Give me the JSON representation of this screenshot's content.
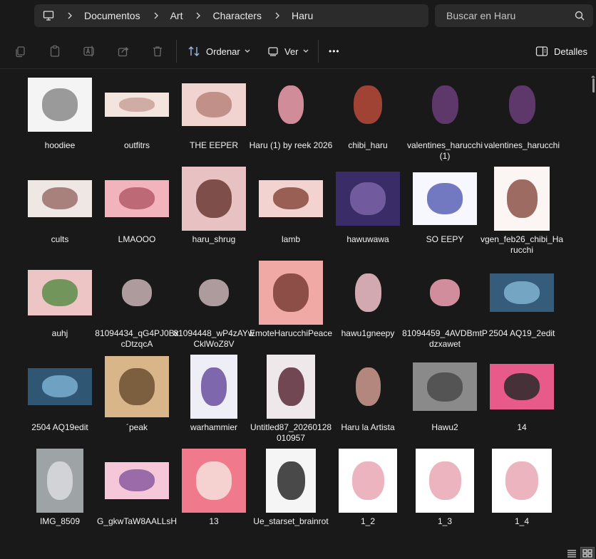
{
  "breadcrumb": {
    "items": [
      "Documentos",
      "Art",
      "Characters",
      "Haru"
    ]
  },
  "search": {
    "placeholder": "Buscar en Haru"
  },
  "toolbar": {
    "sort_label": "Ordenar",
    "view_label": "Ver",
    "details_label": "Detalles",
    "more_label": "•••"
  },
  "files": [
    {
      "name": "hoodiee",
      "thumb": "#f4f4f4",
      "accent": "#8a8a8a"
    },
    {
      "name": "outfitrs",
      "thumb": "#f3e4dd",
      "accent": "#c9a39a"
    },
    {
      "name": "THE EEPER",
      "thumb": "#f1d4cf",
      "accent": "#b8847d"
    },
    {
      "name": "Haru (1) by reek 2026",
      "thumb": "#191919",
      "accent": "#f1a1b0"
    },
    {
      "name": "chibi_haru",
      "thumb": "#191919",
      "accent": "#b84a3a"
    },
    {
      "name": "valentines_harucchi (1)",
      "thumb": "#191919",
      "accent": "#6b3e7a"
    },
    {
      "name": "valentines_harucchi",
      "thumb": "#191919",
      "accent": "#6b3e7a"
    },
    {
      "name": "cults",
      "thumb": "#efe7e4",
      "accent": "#9b6d6a"
    },
    {
      "name": "LMAOOO",
      "thumb": "#f2b3bd",
      "accent": "#b55d6a"
    },
    {
      "name": "haru_shrug",
      "thumb": "#e8c1c2",
      "accent": "#6b3a35"
    },
    {
      "name": "lamb",
      "thumb": "#f3d3d0",
      "accent": "#8a4a3e"
    },
    {
      "name": "hawuwawa",
      "thumb": "#3a2c66",
      "accent": "#7b63a8"
    },
    {
      "name": "SO EEPY",
      "thumb": "#f7f7ff",
      "accent": "#5a63b5"
    },
    {
      "name": "vgen_feb26_chibi_Harucchi",
      "thumb": "#fbf5f4",
      "accent": "#8d5248"
    },
    {
      "name": "auhj",
      "thumb": "#ecc5c4",
      "accent": "#5d8c4a"
    },
    {
      "name": "81094434_qG4PJ0BxcDtzqcA",
      "thumb": "#191919",
      "accent": "#c9b3b6"
    },
    {
      "name": "81094448_wP4zAYwCklWoZ8V",
      "thumb": "#191919",
      "accent": "#c9b3b6"
    },
    {
      "name": "EmoteHarucchiPeace",
      "thumb": "#f0a9a5",
      "accent": "#7a3e36"
    },
    {
      "name": "hawu1gneepy",
      "thumb": "#191919",
      "accent": "#f3c3cb"
    },
    {
      "name": "81094459_4AVDBmtPdzxawet",
      "thumb": "#191919",
      "accent": "#f2a2b4"
    },
    {
      "name": "2504 AQ19_2edit",
      "thumb": "#355c7a",
      "accent": "#7fb2cf"
    },
    {
      "name": "2504 AQ19edit",
      "thumb": "#2f5672",
      "accent": "#79aed0"
    },
    {
      "name": "´peak",
      "thumb": "#d9b58a",
      "accent": "#6b5030"
    },
    {
      "name": "warhammier",
      "thumb": "#eeeef6",
      "accent": "#6b4fa0"
    },
    {
      "name": "Untitled87_20260128010957",
      "thumb": "#efe8ea",
      "accent": "#5a2a3a"
    },
    {
      "name": "Haru la Artista",
      "thumb": "#191919",
      "accent": "#cf9b90"
    },
    {
      "name": "Hawu2",
      "thumb": "#8a8a8a",
      "accent": "#4a4a4a"
    },
    {
      "name": "14",
      "thumb": "#e85a8a",
      "accent": "#2a2a2a"
    },
    {
      "name": "IMG_8509",
      "thumb": "#9ea3a6",
      "accent": "#d9dcde"
    },
    {
      "name": "G_gkwTaW8AALLsH",
      "thumb": "#f5c7d8",
      "accent": "#8a5aa0"
    },
    {
      "name": "13",
      "thumb": "#f07a8c",
      "accent": "#f6e0da"
    },
    {
      "name": "Ue_starset_brainrot",
      "thumb": "#f5f5f5",
      "accent": "#2a2a2a"
    },
    {
      "name": "1_2",
      "thumb": "#ffffff",
      "accent": "#e9a7b3"
    },
    {
      "name": "1_3",
      "thumb": "#ffffff",
      "accent": "#e9a7b3"
    },
    {
      "name": "1_4",
      "thumb": "#ffffff",
      "accent": "#e9a7b3"
    }
  ],
  "colors": {
    "background": "#191919",
    "surface": "#2b2b2b",
    "text": "#ffffff"
  }
}
